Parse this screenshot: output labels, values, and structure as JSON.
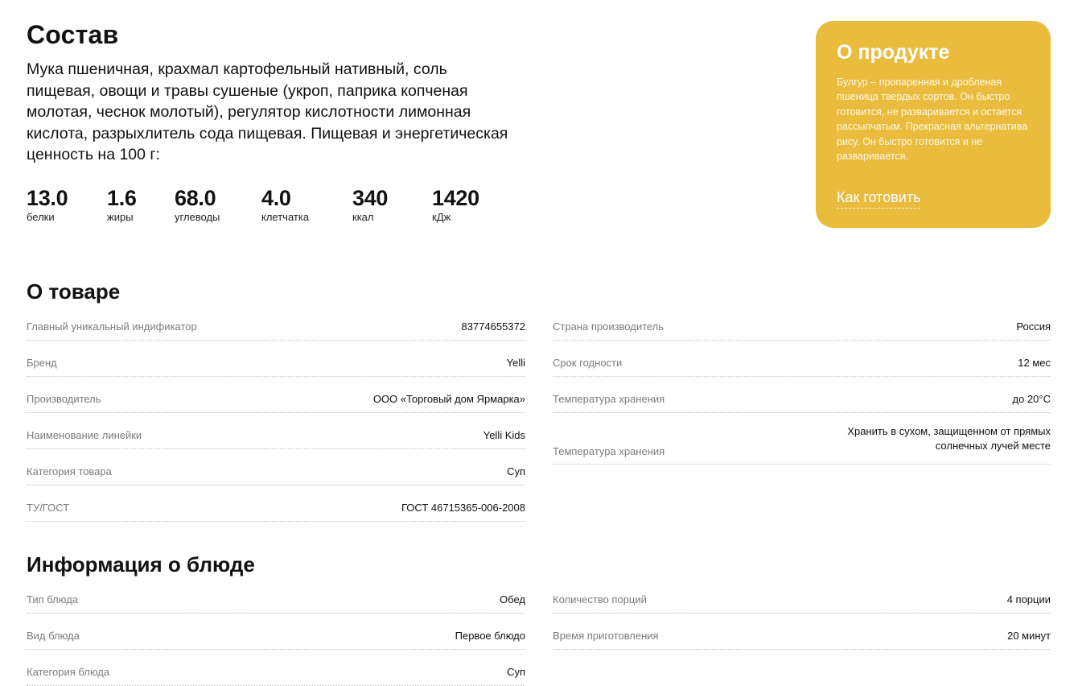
{
  "composition": {
    "title": "Состав",
    "text": "Мука пшеничная, крахмал картофельный нативный, соль пищевая, овощи и травы сушеные (укроп, паприка копченая молотая, чеснок молотый), регулятор кислотности лимонная кислота, разрыхлитель сода пищевая. Пищевая и энергетическая ценность на 100 г:",
    "nutrients": [
      {
        "value": "13.0",
        "label": "белки"
      },
      {
        "value": "1.6",
        "label": "жиры"
      },
      {
        "value": "68.0",
        "label": "углеводы"
      },
      {
        "value": "4.0",
        "label": "клетчатка"
      },
      {
        "value": "340",
        "label": "ккал"
      },
      {
        "value": "1420",
        "label": "кДж"
      }
    ]
  },
  "about_card": {
    "title": "О продукте",
    "text": "Булгур – пропаренная и дробленая пшеница твердых сортов. Он быстро готовится, не разваривается и остается рассыпчатым. Прекрасная альтернатива рису. Он быстро готовится и не разваривается.",
    "link": "Как готовить",
    "bg_color": "#e9bc3e"
  },
  "product_info": {
    "title": "О товаре",
    "left": [
      {
        "key": "Главный уникальный индификатор",
        "value": "83774655372"
      },
      {
        "key": "Бренд",
        "value": "Yelli"
      },
      {
        "key": "Производитель",
        "value": "ООО «Торговый дом Ярмарка»"
      },
      {
        "key": "Наименование линейки",
        "value": "Yelli Kids"
      },
      {
        "key": "Категория товара",
        "value": "Суп"
      },
      {
        "key": "ТУ/ГОСТ",
        "value": "ГОСТ 46715365-006-2008"
      }
    ],
    "right": [
      {
        "key": "Страна производитель",
        "value": "Россия"
      },
      {
        "key": "Срок годности",
        "value": "12 мес"
      },
      {
        "key": "Температура хранения",
        "value": "до 20°С"
      },
      {
        "key": "Температура хранения",
        "value_line1": "Хранить в сухом, защищенном от прямых",
        "value_line2": "солнечных лучей месте"
      }
    ]
  },
  "dish_info": {
    "title": "Информация о блюде",
    "left": [
      {
        "key": "Тип блюда",
        "value": "Обед"
      },
      {
        "key": "Вид блюда",
        "value": "Первое блюдо"
      },
      {
        "key": "Категория блюда",
        "value": "Суп"
      }
    ],
    "right": [
      {
        "key": "Количество порций",
        "value": "4 порции"
      },
      {
        "key": "Время приготовления",
        "value": "20 минут"
      }
    ]
  }
}
